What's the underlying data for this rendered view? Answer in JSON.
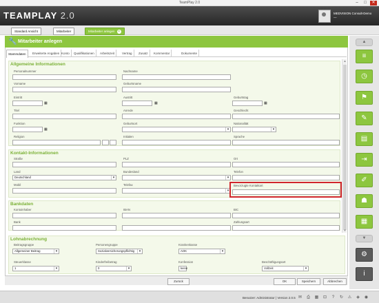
{
  "window": {
    "title": "TeamPlay 2.0",
    "minimize": "–",
    "maximize": "□",
    "close": "✕"
  },
  "app": {
    "logo_main": "TEAMPLAY",
    "logo_version": "2.0",
    "user_line1": "MEDVISION Consult-Demo",
    "user_line2": "—"
  },
  "app_tabs": [
    "Standard Ansicht",
    "Mitarbeiter",
    "Mitarbeiter anlegen"
  ],
  "dialog": {
    "title": "Mitarbeiter anlegen",
    "icon": "🔧"
  },
  "sub_tabs": [
    "Stammdaten",
    "Erweiterte Angaben",
    "Konto",
    "Qualifikationen",
    "Arbeitszeit",
    "Vertrag",
    "Zusatz",
    "Kommentar",
    "Dokumente"
  ],
  "sections": {
    "general": {
      "title": "Allgemeine Informationen",
      "labels": [
        "Personalnummer",
        "Nachname",
        "Vorname",
        "Geburtsname",
        "Eintritt",
        "Austritt",
        "Geburtstag",
        "Titel",
        "Anrede",
        "Geschlecht",
        "Funktion",
        "Geburtsort",
        "Nationalität",
        "Religion",
        "Initialen",
        "Sprache",
        "Personalgruppe",
        "Kostenstelle",
        "Betriebsstätte",
        "Abteilung"
      ],
      "values": {
        "geschlecht": "",
        "funktion": "",
        "personalgruppe": ""
      }
    },
    "contact": {
      "title": "Kontakt-Informationen",
      "labels": [
        "Straße",
        "PLZ",
        "Ort",
        "Land",
        "Bundesland",
        "Telefon",
        "Mobil",
        "Telefax",
        "E-Mail",
        "Bevorzugte Kontaktart"
      ],
      "values": {
        "land": "Deutschland"
      }
    },
    "bank": {
      "title": "Bankdaten",
      "labels": [
        "Kontoinhaber",
        "IBAN",
        "BIC",
        "Bank",
        "Zahlungsart"
      ]
    },
    "payroll": {
      "title": "Lohnabrechnung",
      "labels": [
        "Beitragsgruppe",
        "Personengruppe",
        "Krankenkasse",
        "Steuerklasse",
        "Kinderfreibetrag",
        "Konfession",
        "Beschäftigungsart"
      ],
      "values": {
        "beitragsgruppe": "Allgemeiner Beitrag",
        "personengruppe": "Sozialversicherungspflichtig",
        "krankenkasse": "AOK",
        "steuerklasse": "1",
        "kinderfreibetrag": "0",
        "konfession": "keine",
        "beschaeftigungsart": "Vollzeit"
      }
    }
  },
  "buttons": {
    "prev": "Zurück",
    "next": "Weiter",
    "ok": "OK",
    "save": "Speichern",
    "cancel": "Abbrechen"
  },
  "statusbar": {
    "text": "Benutzer: Administrator  |  Version 2.0.5"
  },
  "colors": {
    "accent": "#8dc63f",
    "header": "#333333",
    "highlight": "#d0262c"
  }
}
